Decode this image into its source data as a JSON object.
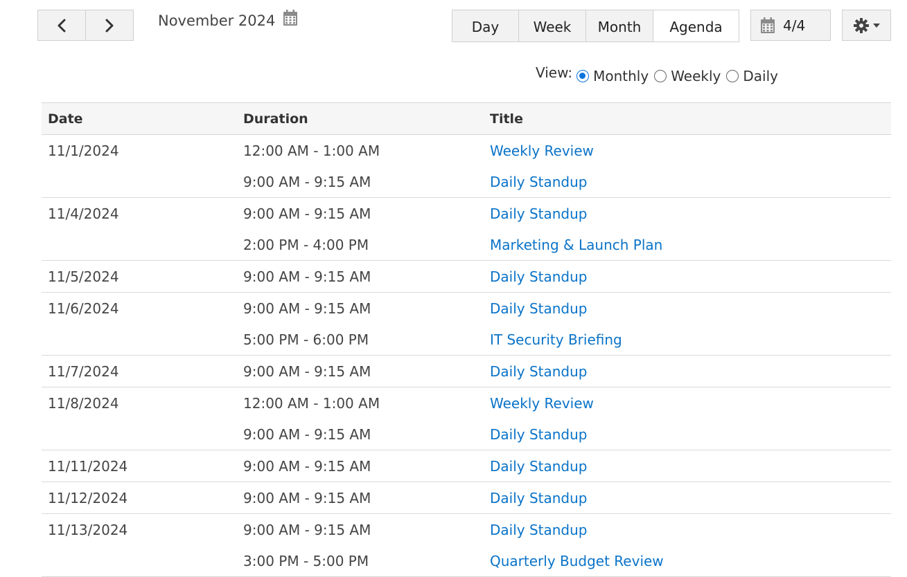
{
  "toolbar": {
    "prev_icon": "chevron-left-icon",
    "next_icon": "chevron-right-icon",
    "period_label": "November 2024",
    "calendar_icon": "calendar-icon",
    "view_tabs": [
      {
        "label": "Day",
        "active": false
      },
      {
        "label": "Week",
        "active": false
      },
      {
        "label": "Month",
        "active": false
      },
      {
        "label": "Agenda",
        "active": true
      }
    ],
    "page_indicator": "4/4",
    "settings_icon": "gear-icon"
  },
  "view_filter": {
    "label": "View:",
    "options": [
      {
        "label": "Monthly",
        "checked": true
      },
      {
        "label": "Weekly",
        "checked": false
      },
      {
        "label": "Daily",
        "checked": false
      }
    ]
  },
  "agenda": {
    "columns": [
      "Date",
      "Duration",
      "Title"
    ],
    "rows": [
      {
        "date": "11/1/2024",
        "duration": "12:00 AM - 1:00 AM",
        "title": "Weekly Review",
        "group_end": false
      },
      {
        "date": "",
        "duration": "9:00 AM - 9:15 AM",
        "title": "Daily Standup",
        "group_end": true
      },
      {
        "date": "11/4/2024",
        "duration": "9:00 AM - 9:15 AM",
        "title": "Daily Standup",
        "group_end": false
      },
      {
        "date": "",
        "duration": "2:00 PM - 4:00 PM",
        "title": "Marketing & Launch Plan",
        "group_end": true
      },
      {
        "date": "11/5/2024",
        "duration": "9:00 AM - 9:15 AM",
        "title": "Daily Standup",
        "group_end": true
      },
      {
        "date": "11/6/2024",
        "duration": "9:00 AM - 9:15 AM",
        "title": "Daily Standup",
        "group_end": false
      },
      {
        "date": "",
        "duration": "5:00 PM - 6:00 PM",
        "title": "IT Security Briefing",
        "group_end": true
      },
      {
        "date": "11/7/2024",
        "duration": "9:00 AM - 9:15 AM",
        "title": "Daily Standup",
        "group_end": true
      },
      {
        "date": "11/8/2024",
        "duration": "12:00 AM - 1:00 AM",
        "title": "Weekly Review",
        "group_end": false
      },
      {
        "date": "",
        "duration": "9:00 AM - 9:15 AM",
        "title": "Daily Standup",
        "group_end": true
      },
      {
        "date": "11/11/2024",
        "duration": "9:00 AM - 9:15 AM",
        "title": "Daily Standup",
        "group_end": true
      },
      {
        "date": "11/12/2024",
        "duration": "9:00 AM - 9:15 AM",
        "title": "Daily Standup",
        "group_end": true
      },
      {
        "date": "11/13/2024",
        "duration": "9:00 AM - 9:15 AM",
        "title": "Daily Standup",
        "group_end": false
      },
      {
        "date": "",
        "duration": "3:00 PM - 5:00 PM",
        "title": "Quarterly Budget Review",
        "group_end": true
      }
    ]
  },
  "colors": {
    "link": "#0a73c8",
    "radio_checked": "#0a73dc",
    "button_bg": "#f2f2f2",
    "border": "#cfcfcf"
  }
}
